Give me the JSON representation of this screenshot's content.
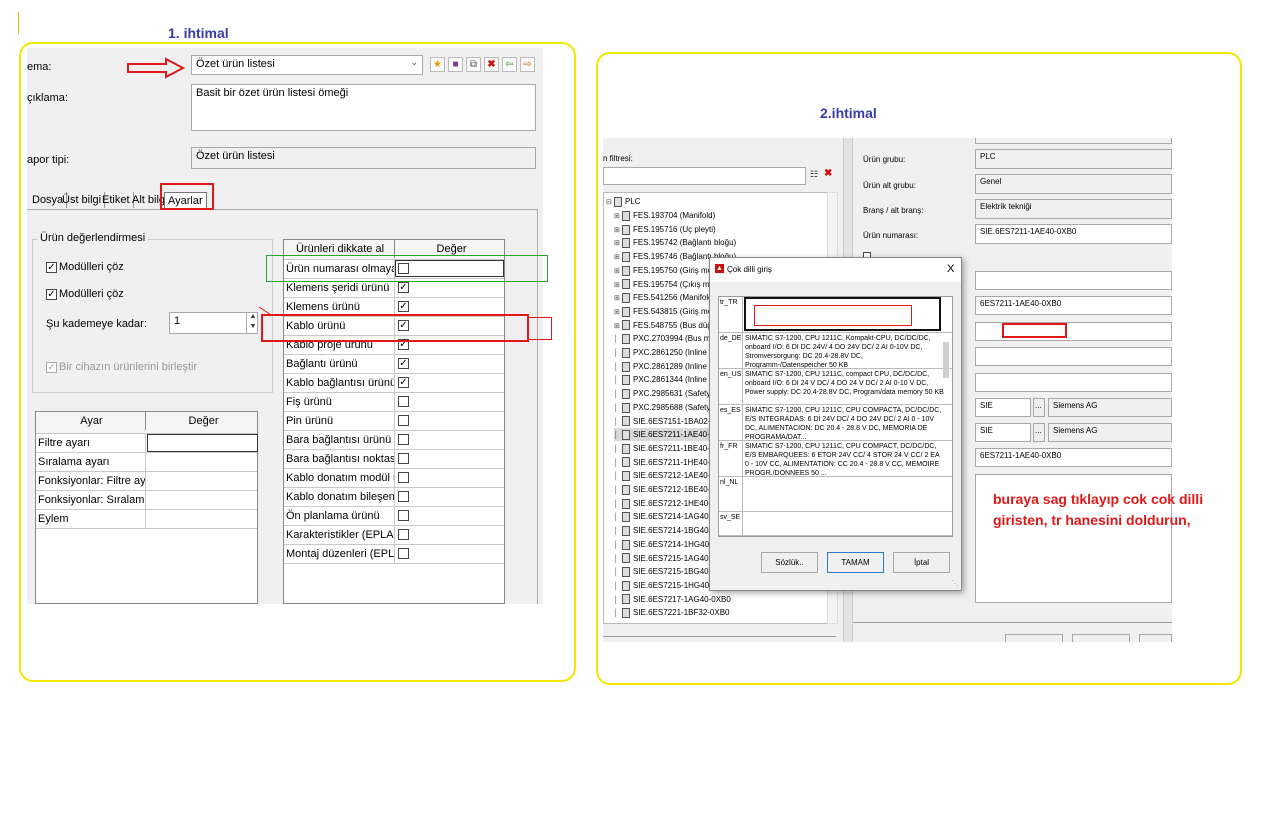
{
  "panel1": {
    "title": "1. ihtimal",
    "labels": {
      "schema": "ema:",
      "desc": "çıklama:",
      "report_type": "apor tipi:"
    },
    "schema_value": "Özet ürün listesi",
    "desc_value": "Basit bir özet ürün listesi ömeği",
    "report_type_value": "Özet ürün listesi",
    "toolbar_icons": [
      "star-icon",
      "save-icon",
      "copy-icon",
      "delete-icon",
      "import-icon",
      "export-icon"
    ],
    "tabs": [
      "Dosya",
      "Üst bilgi",
      "Etiket",
      "Alt bilg",
      "Ayarlar"
    ],
    "group_title": "Ürün değerlendirmesi",
    "check1": "Modülleri çöz",
    "check2": "Modülleri çöz",
    "level_label": "Şu kademeye kadar:",
    "level_value": "1",
    "merge_label": "Bir cihazın ürünlerini birleştir",
    "settings_table": {
      "headers": [
        "Ayar",
        "Değer"
      ],
      "rows": [
        "Filtre ayarı",
        "Sıralama ayarı",
        "Fonksiyonlar: Filtre ayarı",
        "Fonksiyonlar: Sıralama ayarı",
        "Eylem"
      ]
    },
    "products_table": {
      "headers": [
        "Ürünleri dikkate al",
        "Değer"
      ],
      "rows": [
        {
          "label": "Ürün numarası olmayan ci...",
          "checked": false
        },
        {
          "label": "Klemens şeridi ürünü",
          "checked": true
        },
        {
          "label": "Klemens ürünü",
          "checked": true
        },
        {
          "label": "Kablo ürünü",
          "checked": true
        },
        {
          "label": "Kablo proje ürünü",
          "checked": true
        },
        {
          "label": "Bağlantı ürünü",
          "checked": true
        },
        {
          "label": "Kablo bağlantısı ürünü",
          "checked": true
        },
        {
          "label": "Fiş ürünü",
          "checked": false
        },
        {
          "label": "Pin ürünü",
          "checked": false
        },
        {
          "label": "Bara bağlantısı ürünü",
          "checked": false
        },
        {
          "label": "Bara bağlantısı noktası ür...",
          "checked": false
        },
        {
          "label": "Kablo donatım modül ürü...",
          "checked": false
        },
        {
          "label": "Kablo donatım bileşenleri...",
          "checked": false
        },
        {
          "label": "Ön planlama ürünü",
          "checked": false
        },
        {
          "label": "Karakteristikler (EPLAN PP...",
          "checked": false
        },
        {
          "label": "Montaj düzenleri (EPLAN ...",
          "checked": false
        }
      ]
    }
  },
  "panel2": {
    "title": "2.ihtimal",
    "filter_label": "n filtresi:",
    "tree_root": "PLC",
    "tree_items": [
      "FES.193704 (Manifold)",
      "FES.195716 (Uç pleyti)",
      "FES.195742 (Bağlantı bloğu)",
      "FES.195746 (Bağlantı bloğu)",
      "FES.195750 (Giriş modülü)",
      "FES.195754 (Çıkış modülü)",
      "FES.541256 (Manifold)",
      "FES.543815 (Giriş modülü)",
      "FES.548755 (Bus düğümleri)",
      "PXC.2703994 (Bus modülü)",
      "PXC.2861250 (Inline modülü)",
      "PXC.2861289 (Inline modülü)",
      "PXC.2861344 (Inline modülü)",
      "PXC.2985631 (Safety module)",
      "PXC.2985688 (Safety modülü)",
      "SIE.6ES7151-1BA02-0AB0",
      "SIE.6ES7211-1AE40-0XB0",
      "SIE.6ES7211-1BE40-0XB0",
      "SIE.6ES7211-1HE40-0XB0",
      "SIE.6ES7212-1AE40-0XB0",
      "SIE.6ES7212-1BE40-0XB0",
      "SIE.6ES7212-1HE40-0XB0",
      "SIE.6ES7214-1AG40-0XB0",
      "SIE.6ES7214-1BG40-0XB0",
      "SIE.6ES7214-1HG40-0XB0",
      "SIE.6ES7215-1AG40-0XB0",
      "SIE.6ES7215-1BG40-0XB0",
      "SIE.6ES7215-1HG40-0XB0",
      "SIE.6ES7217-1AG40-0XB0",
      "SIE.6ES7221-1BF32-0XB0"
    ],
    "props": {
      "group_label": "Ürün grubu:",
      "group_value": "PLC",
      "subgroup_label": "Ürün alt grubu:",
      "subgroup_value": "Genel",
      "branch_label": "Branş / alt branş:",
      "branch_value": "Elektrik tekniği",
      "number_label": "Ürün numarası:",
      "number_value": "SIE.6ES7211-1AE40-0XB0",
      "type_value": "6ES7211-1AE40-0XB0",
      "maker_code": "SIE",
      "maker_name": "Siemens AG",
      "supplier_code": "SIE",
      "supplier_name": "Siemens AG",
      "order_value": "6ES7211-1AE40-0XB0",
      "browse_btn": "..."
    },
    "dialog": {
      "title": "Çok dilli giriş",
      "close": "X",
      "langs": [
        {
          "code": "tr_TR",
          "text": ""
        },
        {
          "code": "de_DE",
          "text": "SIMATIC S7-1200, CPU 1211C, Kompakt-CPU, DC/DC/DC, onboard I/O: 6 DI DC 24V/ 4 DO 24V DC/ 2 AI 0-10V DC, Stromversorgung: DC 20.4-28.8V DC, Programm-/Datenspeicher 50 KB"
        },
        {
          "code": "en_US",
          "text": "SIMATIC S7-1200, CPU 1211C, compact CPU, DC/DC/DC, onboard I/O: 6 DI 24 V DC/ 4 DO 24 V DC/ 2 AI 0-10 V DC, Power supply: DC 20.4-28.8V DC, Program/data memory 50 KB"
        },
        {
          "code": "es_ES",
          "text": "SIMATIC S7-1200, CPU 1211C, CPU COMPACTA, DC/DC/DC, E/S INTEGRADAS: 6 DI 24V DC/ 4 DO 24V DC/ 2 AI 0 - 10V DC, ALIMENTACION: DC 20.4 - 28.8 V DC, MEMORIA DE PROGRAMA/DAT..."
        },
        {
          "code": "fr_FR",
          "text": "SIMATIC S7-1200, CPU 1211C, CPU COMPACT, DC/DC/DC, E/S EMBARQUEES: 6 ETOR 24V CC/ 4 STOR 24 V CC/ 2 EA 0 - 10V CC, ALIMENTATION: CC 20.4 - 28.8 V CC, MEMOIRE PROGR./DONNEES 50 ..."
        },
        {
          "code": "nl_NL",
          "text": ""
        },
        {
          "code": "sv_SE",
          "text": ""
        }
      ],
      "buttons": [
        "Sözlük..",
        "TAMAM",
        "İptal"
      ]
    },
    "annotation": "buraya sag tıklayıp cok cok dilli giristen, tr hanesini doldurun,"
  },
  "colors": {
    "frame": "#f2e600",
    "highlight": "#e01818",
    "title": "#3a3aa8",
    "green_outline": "#2aa52a"
  }
}
